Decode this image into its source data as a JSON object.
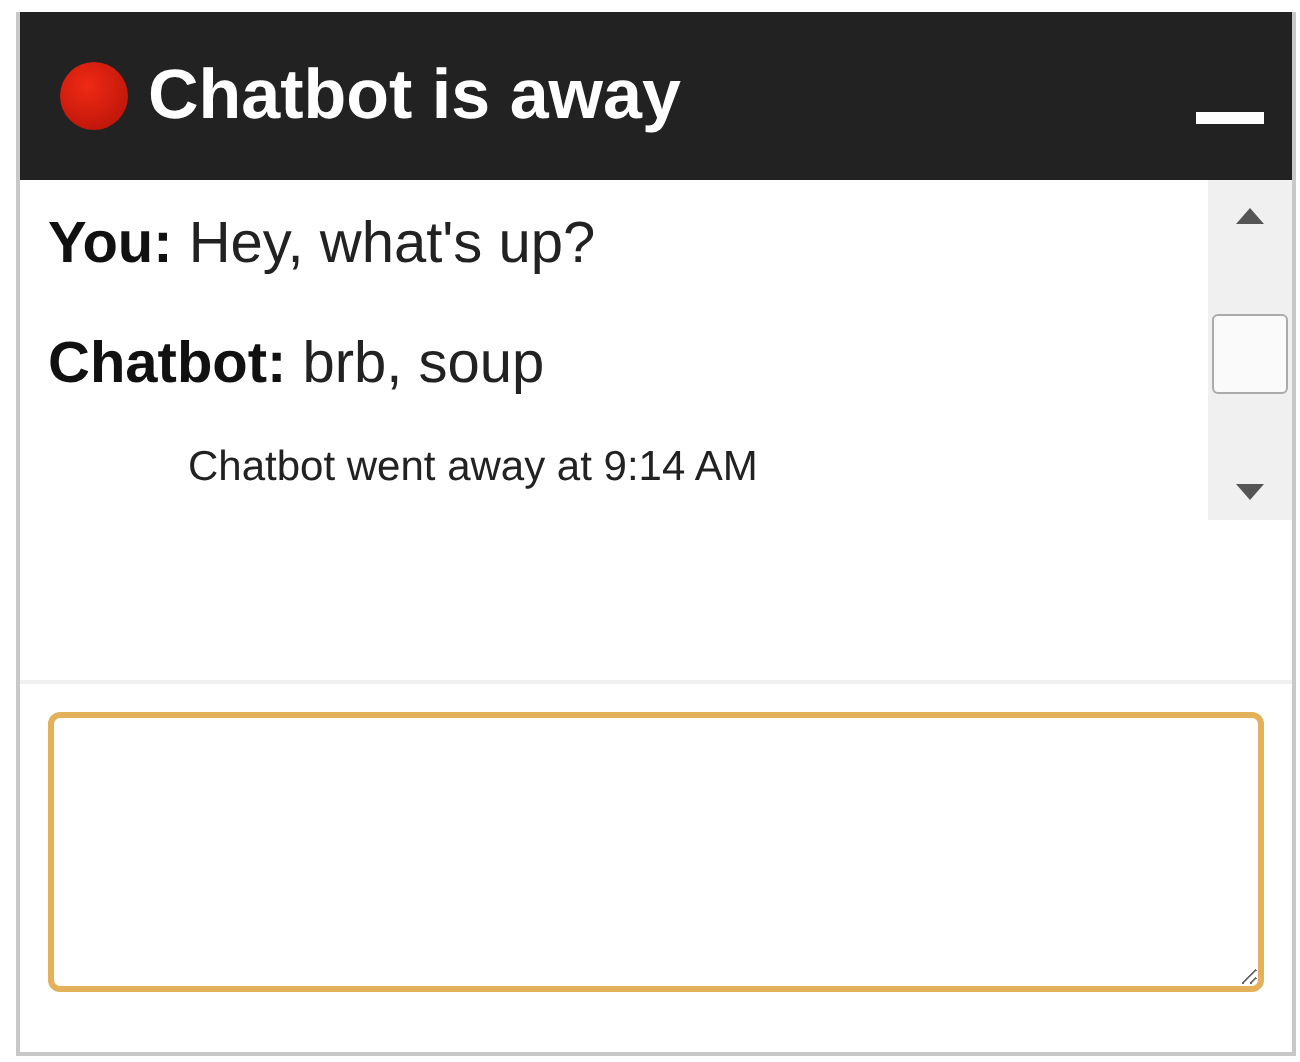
{
  "window": {
    "title": "Chatbot is away",
    "away": true
  },
  "messages": [
    {
      "kind": "message",
      "sender": "You:",
      "text": "Hey, what's up?"
    },
    {
      "kind": "message",
      "sender": "Chatbot:",
      "text": "brb, soup"
    },
    {
      "kind": "notice",
      "text": "Chatbot went away at 9:14 AM"
    }
  ],
  "input": {
    "focused": true
  }
}
